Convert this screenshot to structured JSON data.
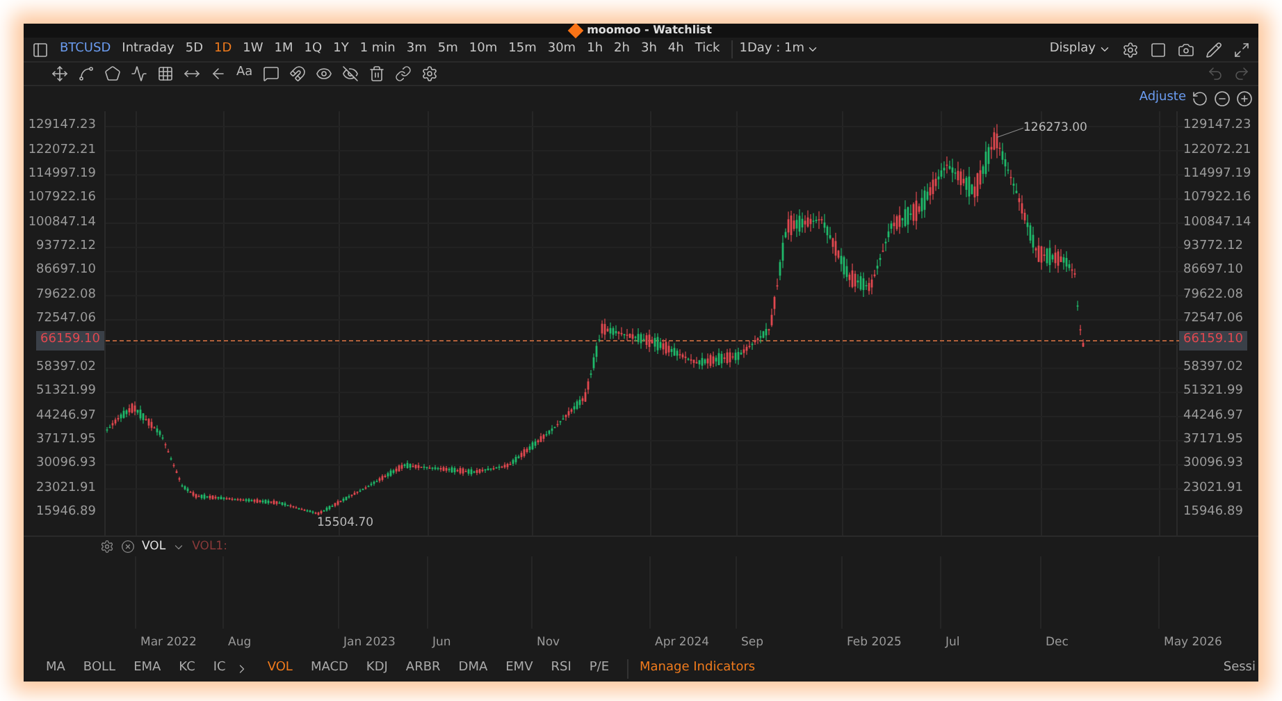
{
  "window": {
    "title": "moomoo - Watchlist"
  },
  "toolbar": {
    "symbol": "BTCUSD",
    "intervals": [
      {
        "label": "Intraday",
        "selected": false
      },
      {
        "label": "5D",
        "selected": false
      },
      {
        "label": "1D",
        "selected": true
      },
      {
        "label": "1W",
        "selected": false
      },
      {
        "label": "1M",
        "selected": false
      },
      {
        "label": "1Q",
        "selected": false
      },
      {
        "label": "1Y",
        "selected": false
      },
      {
        "label": "1 min",
        "selected": false
      },
      {
        "label": "3m",
        "selected": false
      },
      {
        "label": "5m",
        "selected": false
      },
      {
        "label": "10m",
        "selected": false
      },
      {
        "label": "15m",
        "selected": false
      },
      {
        "label": "30m",
        "selected": false
      },
      {
        "label": "1h",
        "selected": false
      },
      {
        "label": "2h",
        "selected": false
      },
      {
        "label": "3h",
        "selected": false
      },
      {
        "label": "4h",
        "selected": false
      },
      {
        "label": "Tick",
        "selected": false
      }
    ],
    "interval_dropdown": "1Day : 1m",
    "display": "Display"
  },
  "drawing_tools": {
    "text_tool": "Aa"
  },
  "chart": {
    "mode": "Adjuste",
    "high_label": "126273.00",
    "low_label": "15504.70",
    "left_axis": {
      "labels": [
        "129147.23",
        "122072.21",
        "114997.19",
        "107922.16",
        "100847.14",
        "93772.12",
        "86697.10",
        "79622.08",
        "72547.06",
        "58397.02",
        "51321.99",
        "44246.97",
        "37171.95",
        "30096.93",
        "23021.91",
        "15946.89"
      ],
      "current_price": "66159.10"
    },
    "right_axis": {
      "labels": [
        "129147.23",
        "122072.21",
        "114997.19",
        "107922.16",
        "100847.14",
        "93772.12",
        "86697.10",
        "79622.08",
        "72547.06",
        "58397.02",
        "51321.99",
        "44246.97",
        "37171.95",
        "30096.93",
        "23021.91",
        "15946.89"
      ],
      "current_price": "66159.10"
    },
    "x_axis_labels": [
      "Mar 2022",
      "Aug",
      "Jan 2023",
      "Jun",
      "Nov",
      "Apr 2024",
      "Sep",
      "Feb 2025",
      "Jul",
      "Dec",
      "May 2026"
    ]
  },
  "volume_panel": {
    "name": "VOL",
    "legend": "VOL1:"
  },
  "indicators": {
    "main": [
      {
        "label": "MA",
        "selected": false
      },
      {
        "label": "BOLL",
        "selected": false
      },
      {
        "label": "EMA",
        "selected": false
      },
      {
        "label": "KC",
        "selected": false
      },
      {
        "label": "IC",
        "selected": false
      }
    ],
    "sub": [
      {
        "label": "VOL",
        "selected": true
      },
      {
        "label": "MACD",
        "selected": false
      },
      {
        "label": "KDJ",
        "selected": false
      },
      {
        "label": "ARBR",
        "selected": false
      },
      {
        "label": "DMA",
        "selected": false
      },
      {
        "label": "EMV",
        "selected": false
      },
      {
        "label": "RSI",
        "selected": false
      },
      {
        "label": "P/E",
        "selected": false
      }
    ],
    "manage": "Manage Indicators"
  },
  "status": {
    "session": "Sessi"
  }
}
